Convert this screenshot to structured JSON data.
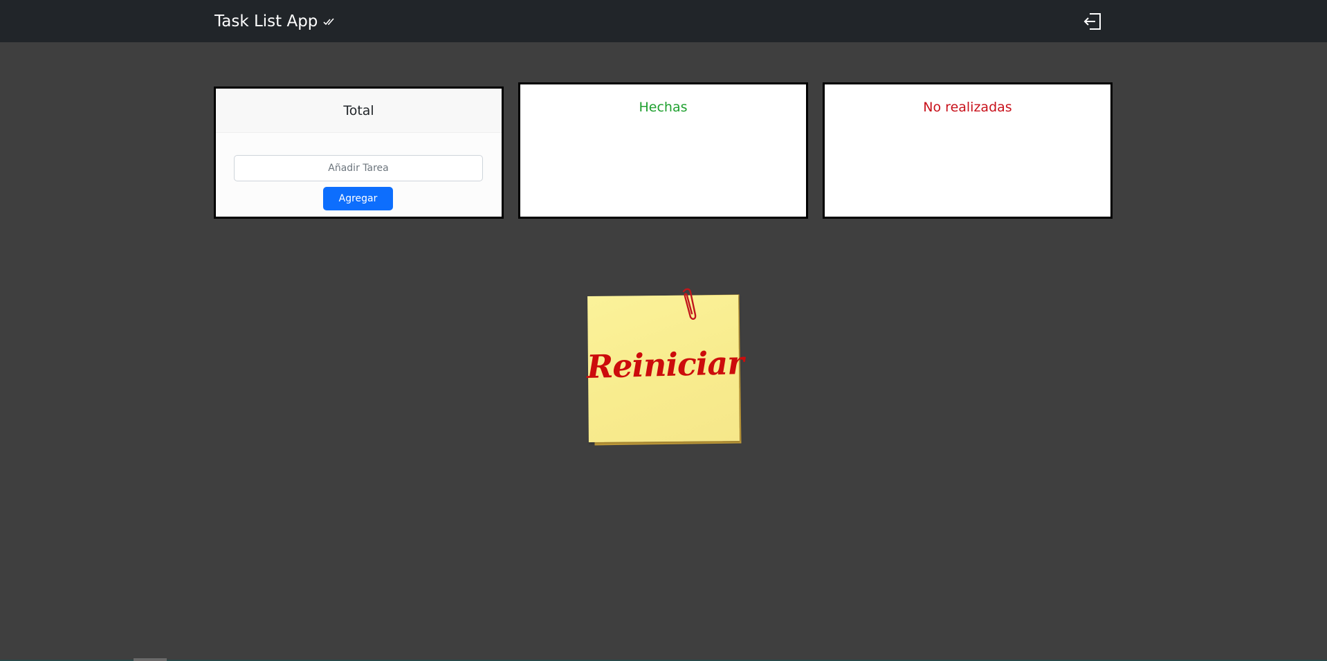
{
  "navbar": {
    "brand": "Task List App",
    "brand_icon": "double-check-icon",
    "logout_icon": "logout-icon"
  },
  "cards": {
    "total": {
      "title": "Total",
      "input_placeholder": "Añadir Tarea",
      "input_value": "",
      "add_label": "Agregar"
    },
    "hechas": {
      "title": "Hechas"
    },
    "no_realizadas": {
      "title": "No realizadas"
    }
  },
  "reset": {
    "label": "Reiniciar",
    "icon": "paperclip-icon"
  },
  "colors": {
    "navbar_bg": "#212529",
    "page_bg": "#3f3f3f",
    "done": "#1fa02f",
    "not_done": "#c8101a",
    "primary": "#0d6efd",
    "sticky": "#f8ec8e"
  }
}
